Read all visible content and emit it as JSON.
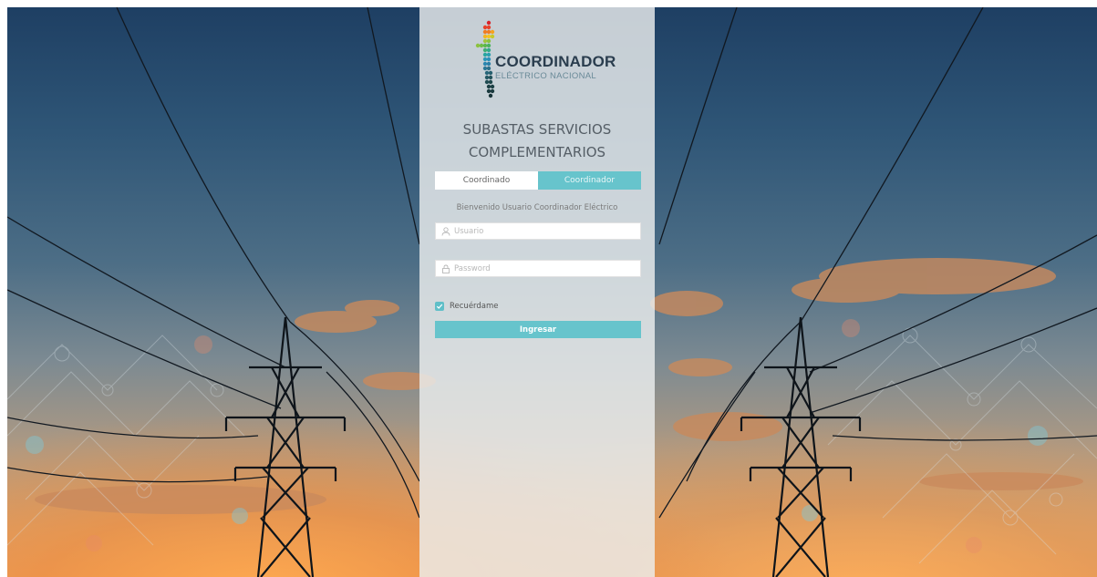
{
  "brand": {
    "name": "COORDINADOR",
    "subtitle": "ELÉCTRICO NACIONAL"
  },
  "login": {
    "title_line1": "SUBASTAS SERVICIOS",
    "title_line2": "COMPLEMENTARIOS",
    "tabs": [
      {
        "label": "Coordinado",
        "active": false
      },
      {
        "label": "Coordinador",
        "active": true
      }
    ],
    "welcome": "Bienvenido Usuario Coordinador Eléctrico",
    "username_placeholder": "Usuario",
    "password_placeholder": "Password",
    "remember_label": "Recuérdame",
    "remember_checked": true,
    "submit_label": "Ingresar"
  },
  "icons": {
    "username": "user-icon",
    "password": "lock-icon",
    "remember": "check-icon"
  },
  "colors": {
    "accent": "#67c4cc",
    "panel": "#eceeee",
    "text": "#555e66"
  }
}
